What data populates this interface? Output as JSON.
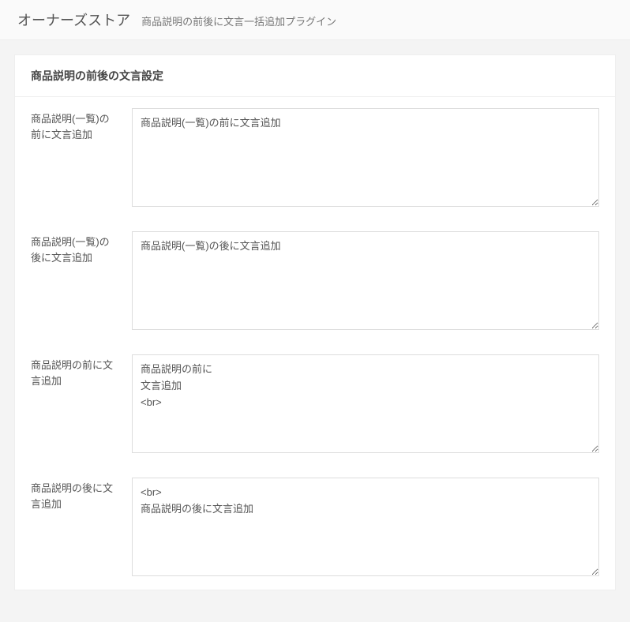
{
  "header": {
    "title": "オーナーズストア",
    "subtitle": "商品説明の前後に文言一括追加プラグイン"
  },
  "card": {
    "title": "商品説明の前後の文言設定"
  },
  "fields": {
    "list_before": {
      "label": "商品説明(一覧)の前に文言追加",
      "value": "商品説明(一覧)の前に文言追加"
    },
    "list_after": {
      "label": "商品説明(一覧)の後に文言追加",
      "value": "商品説明(一覧)の後に文言追加"
    },
    "detail_before": {
      "label": "商品説明の前に文言追加",
      "value": "商品説明の前に\n文言追加\n<br>"
    },
    "detail_after": {
      "label": "商品説明の後に文言追加",
      "value": "<br>\n商品説明の後に文言追加"
    }
  }
}
